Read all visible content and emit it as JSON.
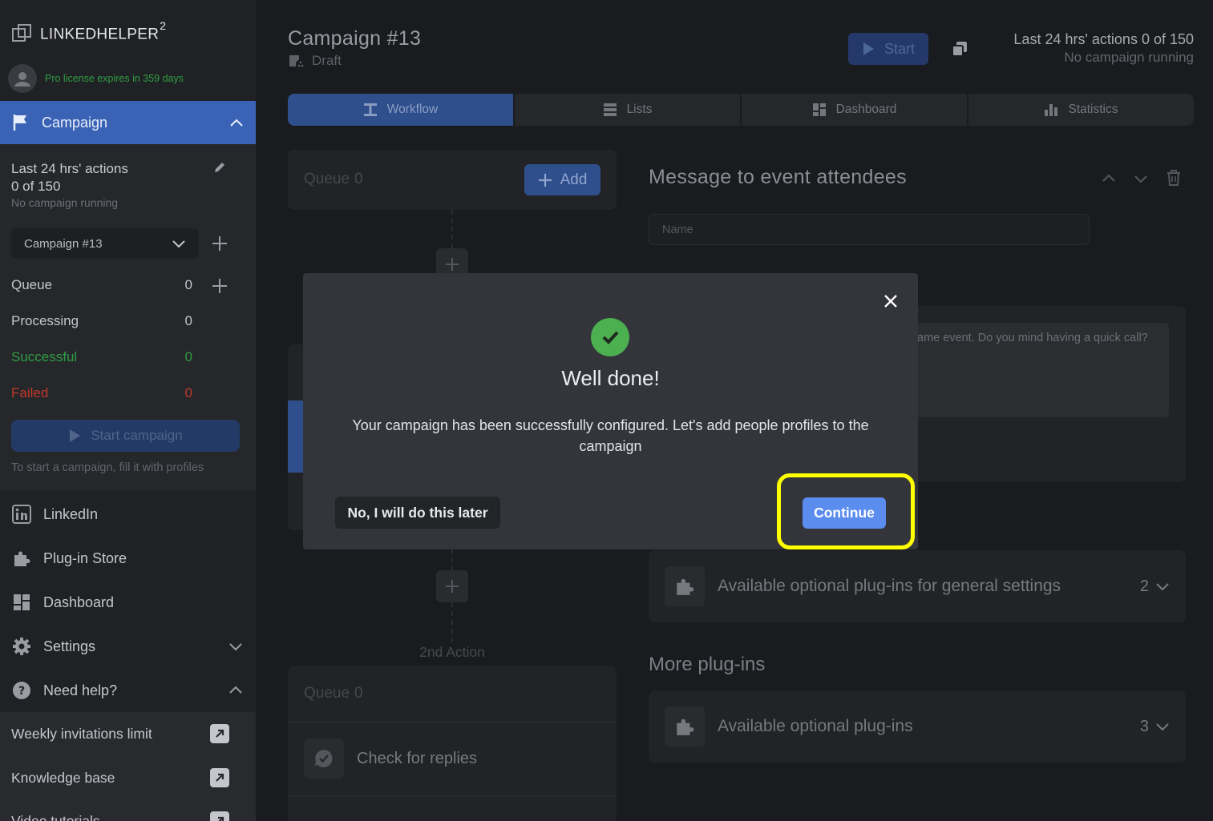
{
  "app": {
    "brand": "LINKEDHELPER",
    "brand_superscript": "2",
    "license_text": "Pro license expires in 359 days"
  },
  "sidebar": {
    "campaign_section": "Campaign",
    "last24_label": "Last 24 hrs' actions",
    "last24_value": "0 of 150",
    "no_campaign": "No campaign running",
    "selected_campaign": "Campaign #13",
    "stats": [
      {
        "label": "Queue",
        "value": "0",
        "color": "#c4c6cc"
      },
      {
        "label": "Processing",
        "value": "0",
        "color": "#c4c6cc"
      },
      {
        "label": "Successful",
        "value": "0",
        "color": "#2f9e44"
      },
      {
        "label": "Failed",
        "value": "0",
        "color": "#c0392b"
      }
    ],
    "start_campaign": "Start campaign",
    "start_hint": "To start a campaign, fill it with profiles",
    "nav": {
      "linkedin": "LinkedIn",
      "plugin_store": "Plug-in Store",
      "dashboard": "Dashboard",
      "settings": "Settings",
      "need_help": "Need help?"
    },
    "help_links": {
      "weekly_limit": "Weekly invitations limit",
      "knowledge_base": "Knowledge base",
      "video_tutorials": "Video tutorials"
    }
  },
  "header": {
    "title": "Campaign #13",
    "status": "Draft",
    "start_label": "Start",
    "last24_line": "Last 24 hrs' actions 0 of 150",
    "no_campaign": "No campaign running"
  },
  "tabs": [
    {
      "label": "Workflow",
      "icon": "workflow-icon"
    },
    {
      "label": "Lists",
      "icon": "lists-icon"
    },
    {
      "label": "Dashboard",
      "icon": "dashboard-icon"
    },
    {
      "label": "Statistics",
      "icon": "statistics-icon"
    }
  ],
  "workflow": {
    "queue_label": "Queue",
    "queue_count": "0",
    "add_label": "Add",
    "second_action_label": "2nd Action",
    "queue2_label": "Queue",
    "queue2_count": "0",
    "check_replies": "Check for replies"
  },
  "action_panel": {
    "title": "Message to event attendees",
    "name_placeholder": "Name",
    "message_text": "ame event. Do you mind having a quick call?",
    "plugins_general": "Available optional plug-ins for general settings",
    "plugins_general_count": "2",
    "more_plugins_title": "More plug-ins",
    "plugins_more": "Available optional plug-ins",
    "plugins_more_count": "3"
  },
  "modal": {
    "title": "Well done!",
    "body": "Your campaign has been successfully configured. Let's add people profiles to the campaign",
    "later_label": "No, I will do this later",
    "continue_label": "Continue"
  },
  "colors": {
    "accent": "#5b8def",
    "success": "#4caf50",
    "highlight": "#ffff00"
  }
}
